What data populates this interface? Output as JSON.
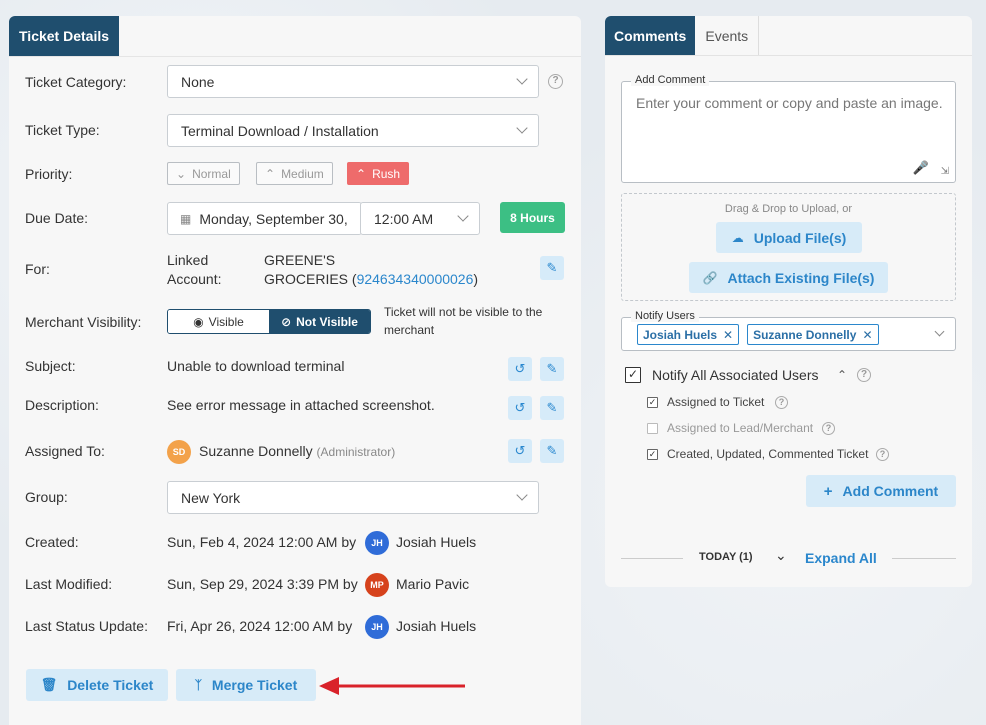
{
  "left": {
    "tab_label": "Ticket Details",
    "category": {
      "label": "Ticket Category:",
      "value": "None"
    },
    "type": {
      "label": "Ticket Type:",
      "value": "Terminal Download / Installation"
    },
    "priority": {
      "label": "Priority:",
      "options": [
        "Normal",
        "Medium",
        "Rush"
      ],
      "selected": "Rush"
    },
    "due": {
      "label": "Due Date:",
      "date": "Monday, September 30,",
      "time": "12:00 AM",
      "badge": "8 Hours"
    },
    "for": {
      "label": "For:",
      "sub_label_1": "Linked",
      "sub_label_2": "Account:",
      "name_1": "GREENE'S",
      "name_2": "GROCERIES (",
      "account_id": "924634340000026",
      "close_paren": ")"
    },
    "visibility": {
      "label": "Merchant Visibility:",
      "visible": "Visible",
      "not_visible": "Not Visible",
      "note": "Ticket will not be visible to the merchant"
    },
    "subject": {
      "label": "Subject:",
      "value": "Unable to download terminal"
    },
    "description": {
      "label": "Description:",
      "value": "See error message in attached screenshot."
    },
    "assigned": {
      "label": "Assigned To:",
      "initials": "SD",
      "name": "Suzanne Donnelly",
      "role": "(Administrator)"
    },
    "group": {
      "label": "Group:",
      "value": "New York"
    },
    "created": {
      "label": "Created:",
      "value": "Sun, Feb 4, 2024 12:00 AM by",
      "initials": "JH",
      "user": "Josiah Huels"
    },
    "modified": {
      "label": "Last Modified:",
      "value": "Sun, Sep 29, 2024 3:39 PM by",
      "initials": "MP",
      "user": "Mario Pavic"
    },
    "status_update": {
      "label": "Last Status Update:",
      "value": "Fri, Apr 26, 2024 12:00 AM by",
      "initials": "JH",
      "user": "Josiah Huels"
    },
    "delete_label": "Delete Ticket",
    "merge_label": "Merge Ticket"
  },
  "right": {
    "tabs": [
      "Comments",
      "Events"
    ],
    "add_comment_legend": "Add Comment",
    "comment_placeholder": "Enter your comment or copy and paste an image.",
    "drag_text": "Drag & Drop to Upload, or",
    "upload_label": "Upload File(s)",
    "attach_label": "Attach Existing File(s)",
    "notify_legend": "Notify Users",
    "notify_chips": [
      "Josiah Huels",
      "Suzanne Donnelly"
    ],
    "notify_all_label": "Notify All Associated Users",
    "options": [
      {
        "label": "Assigned to Ticket",
        "checked": true
      },
      {
        "label": "Assigned to Lead/Merchant",
        "checked": false
      },
      {
        "label": "Created, Updated, Commented Ticket",
        "checked": true
      }
    ],
    "add_comment_button": "Add Comment",
    "today_label": "TODAY (1)",
    "expand_all": "Expand All"
  },
  "colors": {
    "primary": "#1f4e6e",
    "rush": "#ee6b6b",
    "badge_green": "#3cbf84",
    "link": "#2b87cc",
    "arrow": "#d9222a"
  }
}
